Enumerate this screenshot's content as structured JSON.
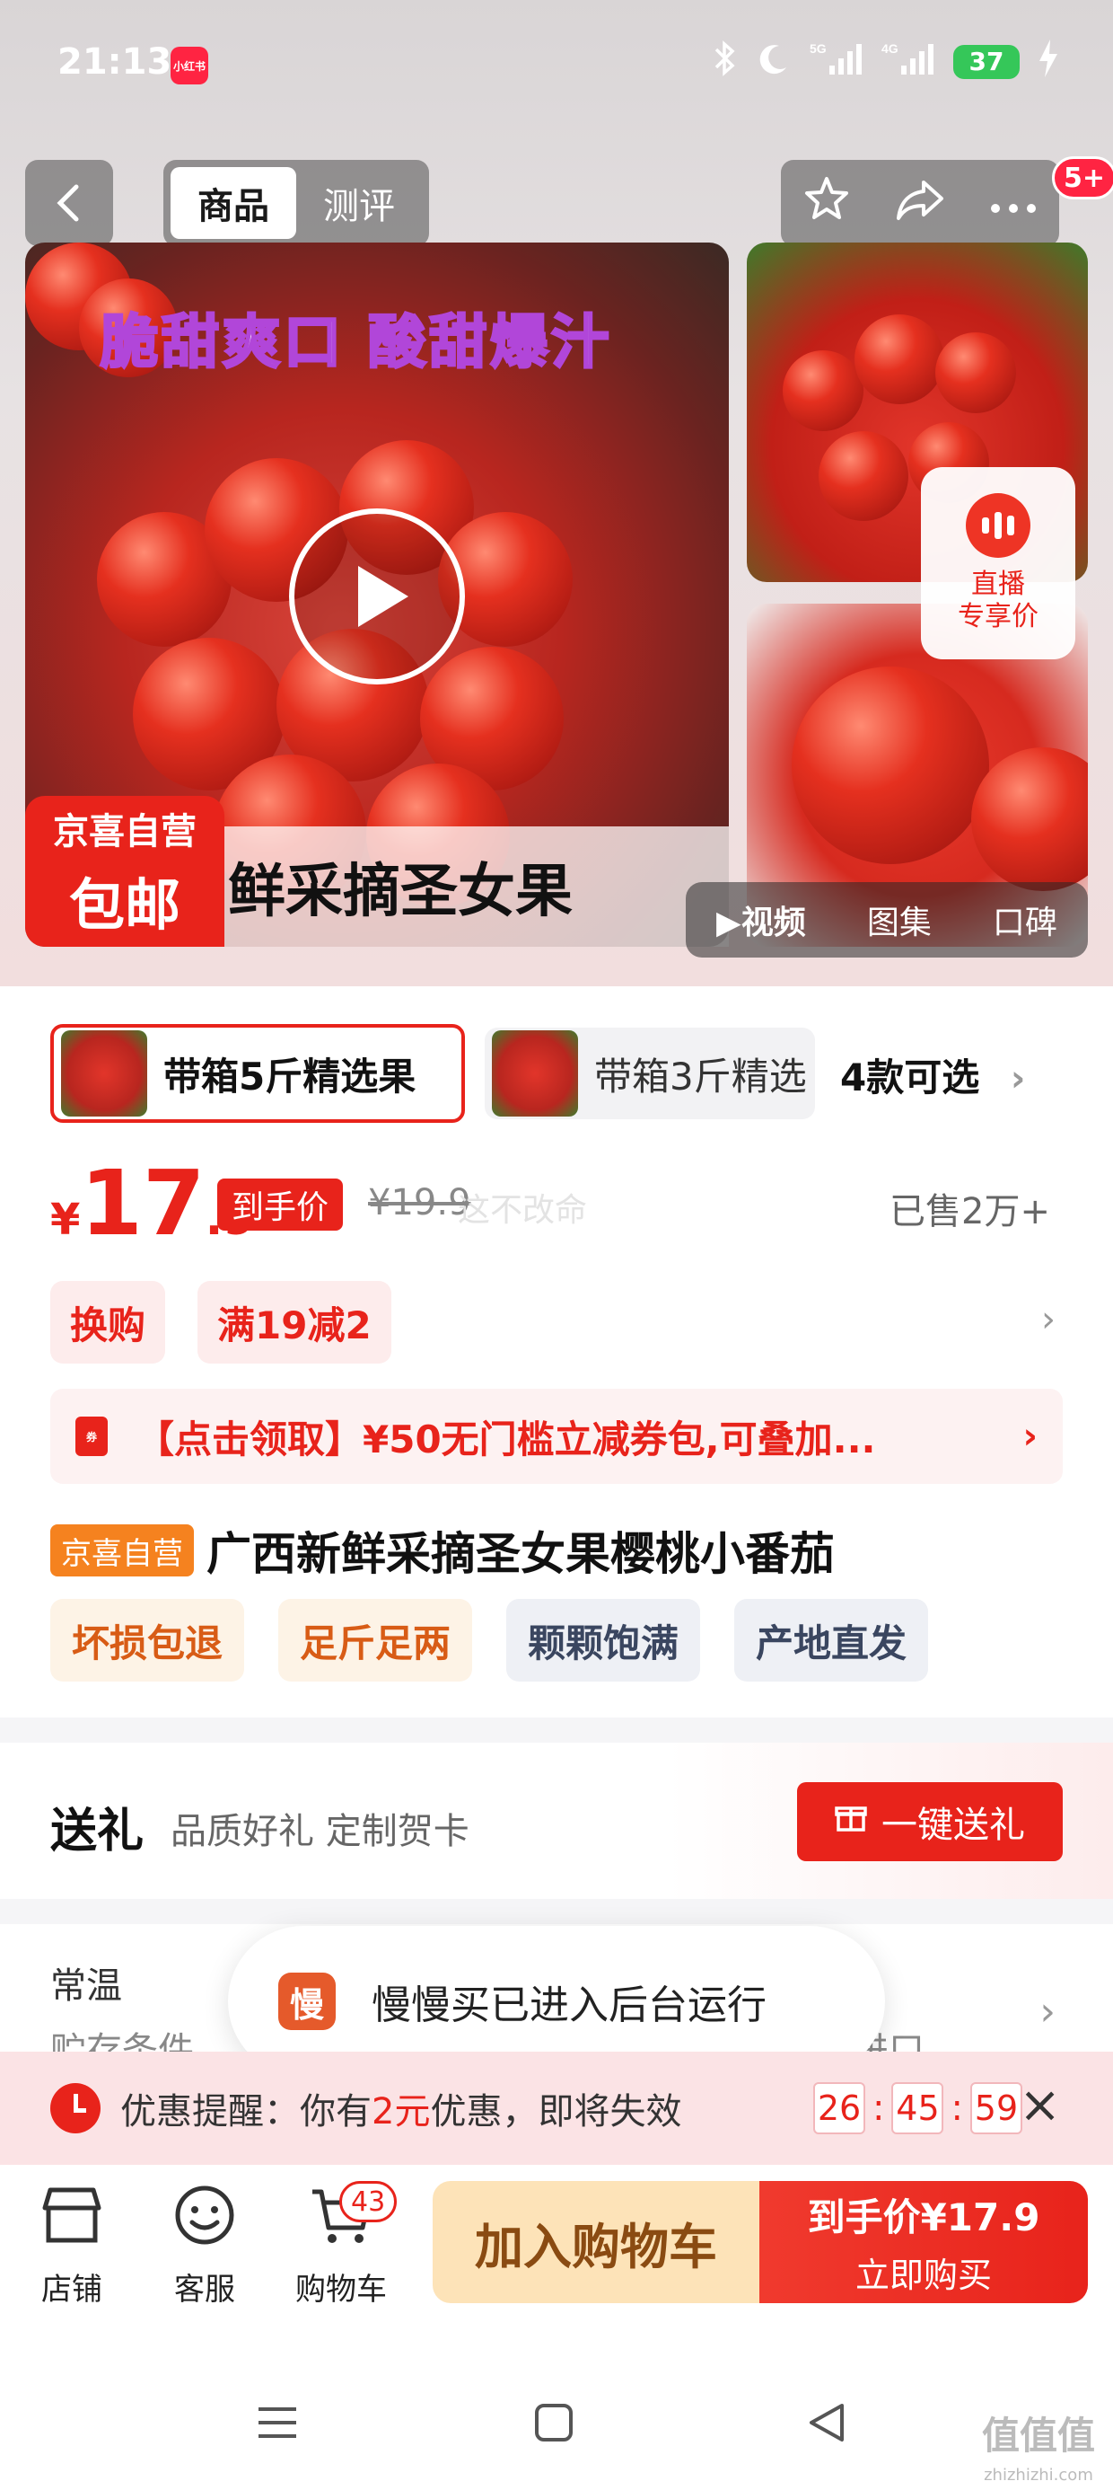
{
  "status_bar": {
    "time": "21:13",
    "app_badge": "小红书",
    "network": [
      "5G",
      "4G"
    ],
    "battery": "37"
  },
  "nav": {
    "tabs": [
      {
        "label": "商品",
        "active": true
      },
      {
        "label": "测评",
        "active": false
      }
    ],
    "more_badge": "5+"
  },
  "gallery": {
    "slogan": "脆甜爽口  酸甜爆汁",
    "caption": "鲜采摘圣女果",
    "badge_line1": "京喜自营",
    "badge_line2": "包邮",
    "live_label_1": "直播",
    "live_label_2": "专享价",
    "media_tabs": [
      {
        "label": "视频",
        "active": true
      },
      {
        "label": "图集",
        "active": false
      },
      {
        "label": "口碑",
        "active": false
      }
    ]
  },
  "variants": {
    "items": [
      {
        "label": "带箱5斤精选果",
        "selected": true
      },
      {
        "label": "带箱3斤精选",
        "selected": false
      }
    ],
    "count_label": "4款可选"
  },
  "price": {
    "symbol": "¥",
    "integer": "17",
    "decimal": ".9",
    "tag": "到手价",
    "original": "¥19.9",
    "sold": "已售2万+"
  },
  "promos": [
    "换购",
    "满19减2"
  ],
  "coupon": {
    "icon_text": "券",
    "text": "【点击领取】¥50无门槛立减券包,可叠加..."
  },
  "product": {
    "tag": "京喜自营",
    "title": "广西新鲜采摘圣女果樱桃小番茄",
    "features": [
      {
        "label": "坏损包退",
        "style": "orange"
      },
      {
        "label": "足斤足两",
        "style": "orange"
      },
      {
        "label": "颗颗饱满",
        "style": "gray"
      },
      {
        "label": "产地直发",
        "style": "gray"
      }
    ]
  },
  "gift": {
    "title": "送礼",
    "subtitle": "品质好礼 定制贺卡",
    "button": "一键送礼"
  },
  "storage": {
    "label": "常温",
    "sub": "贮存条件",
    "sub_right": "进口"
  },
  "toast": {
    "icon_text": "慢",
    "text": "慢慢买已进入后台运行"
  },
  "reminder": {
    "prefix": "优惠提醒：你有",
    "amount": "2元",
    "suffix": "优惠，即将失效",
    "countdown": [
      "26",
      "45",
      "59"
    ]
  },
  "bottom_bar": {
    "shop": "店铺",
    "service": "客服",
    "cart": "购物车",
    "cart_count": "43",
    "add_to_cart": "加入购物车",
    "buy_line1": "到手价¥17.9",
    "buy_line2": "立即购买"
  },
  "watermark": {
    "main": "值值值",
    "sub": "zhizhizhi.com",
    "inline": "这不改命"
  },
  "colors": {
    "accent": "#e8231b",
    "badge_orange": "#f5821f",
    "add_cart_bg": "#fde3b8"
  }
}
